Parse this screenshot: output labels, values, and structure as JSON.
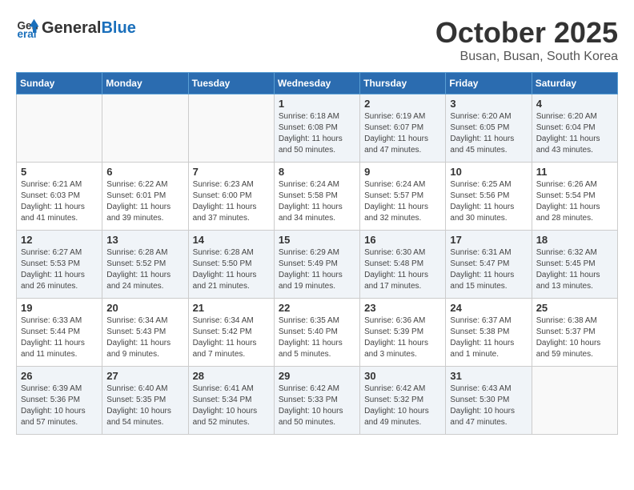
{
  "header": {
    "logo_general": "General",
    "logo_blue": "Blue",
    "month": "October 2025",
    "location": "Busan, Busan, South Korea"
  },
  "weekdays": [
    "Sunday",
    "Monday",
    "Tuesday",
    "Wednesday",
    "Thursday",
    "Friday",
    "Saturday"
  ],
  "weeks": [
    [
      {
        "day": "",
        "info": ""
      },
      {
        "day": "",
        "info": ""
      },
      {
        "day": "",
        "info": ""
      },
      {
        "day": "1",
        "info": "Sunrise: 6:18 AM\nSunset: 6:08 PM\nDaylight: 11 hours\nand 50 minutes."
      },
      {
        "day": "2",
        "info": "Sunrise: 6:19 AM\nSunset: 6:07 PM\nDaylight: 11 hours\nand 47 minutes."
      },
      {
        "day": "3",
        "info": "Sunrise: 6:20 AM\nSunset: 6:05 PM\nDaylight: 11 hours\nand 45 minutes."
      },
      {
        "day": "4",
        "info": "Sunrise: 6:20 AM\nSunset: 6:04 PM\nDaylight: 11 hours\nand 43 minutes."
      }
    ],
    [
      {
        "day": "5",
        "info": "Sunrise: 6:21 AM\nSunset: 6:03 PM\nDaylight: 11 hours\nand 41 minutes."
      },
      {
        "day": "6",
        "info": "Sunrise: 6:22 AM\nSunset: 6:01 PM\nDaylight: 11 hours\nand 39 minutes."
      },
      {
        "day": "7",
        "info": "Sunrise: 6:23 AM\nSunset: 6:00 PM\nDaylight: 11 hours\nand 37 minutes."
      },
      {
        "day": "8",
        "info": "Sunrise: 6:24 AM\nSunset: 5:58 PM\nDaylight: 11 hours\nand 34 minutes."
      },
      {
        "day": "9",
        "info": "Sunrise: 6:24 AM\nSunset: 5:57 PM\nDaylight: 11 hours\nand 32 minutes."
      },
      {
        "day": "10",
        "info": "Sunrise: 6:25 AM\nSunset: 5:56 PM\nDaylight: 11 hours\nand 30 minutes."
      },
      {
        "day": "11",
        "info": "Sunrise: 6:26 AM\nSunset: 5:54 PM\nDaylight: 11 hours\nand 28 minutes."
      }
    ],
    [
      {
        "day": "12",
        "info": "Sunrise: 6:27 AM\nSunset: 5:53 PM\nDaylight: 11 hours\nand 26 minutes."
      },
      {
        "day": "13",
        "info": "Sunrise: 6:28 AM\nSunset: 5:52 PM\nDaylight: 11 hours\nand 24 minutes."
      },
      {
        "day": "14",
        "info": "Sunrise: 6:28 AM\nSunset: 5:50 PM\nDaylight: 11 hours\nand 21 minutes."
      },
      {
        "day": "15",
        "info": "Sunrise: 6:29 AM\nSunset: 5:49 PM\nDaylight: 11 hours\nand 19 minutes."
      },
      {
        "day": "16",
        "info": "Sunrise: 6:30 AM\nSunset: 5:48 PM\nDaylight: 11 hours\nand 17 minutes."
      },
      {
        "day": "17",
        "info": "Sunrise: 6:31 AM\nSunset: 5:47 PM\nDaylight: 11 hours\nand 15 minutes."
      },
      {
        "day": "18",
        "info": "Sunrise: 6:32 AM\nSunset: 5:45 PM\nDaylight: 11 hours\nand 13 minutes."
      }
    ],
    [
      {
        "day": "19",
        "info": "Sunrise: 6:33 AM\nSunset: 5:44 PM\nDaylight: 11 hours\nand 11 minutes."
      },
      {
        "day": "20",
        "info": "Sunrise: 6:34 AM\nSunset: 5:43 PM\nDaylight: 11 hours\nand 9 minutes."
      },
      {
        "day": "21",
        "info": "Sunrise: 6:34 AM\nSunset: 5:42 PM\nDaylight: 11 hours\nand 7 minutes."
      },
      {
        "day": "22",
        "info": "Sunrise: 6:35 AM\nSunset: 5:40 PM\nDaylight: 11 hours\nand 5 minutes."
      },
      {
        "day": "23",
        "info": "Sunrise: 6:36 AM\nSunset: 5:39 PM\nDaylight: 11 hours\nand 3 minutes."
      },
      {
        "day": "24",
        "info": "Sunrise: 6:37 AM\nSunset: 5:38 PM\nDaylight: 11 hours\nand 1 minute."
      },
      {
        "day": "25",
        "info": "Sunrise: 6:38 AM\nSunset: 5:37 PM\nDaylight: 10 hours\nand 59 minutes."
      }
    ],
    [
      {
        "day": "26",
        "info": "Sunrise: 6:39 AM\nSunset: 5:36 PM\nDaylight: 10 hours\nand 57 minutes."
      },
      {
        "day": "27",
        "info": "Sunrise: 6:40 AM\nSunset: 5:35 PM\nDaylight: 10 hours\nand 54 minutes."
      },
      {
        "day": "28",
        "info": "Sunrise: 6:41 AM\nSunset: 5:34 PM\nDaylight: 10 hours\nand 52 minutes."
      },
      {
        "day": "29",
        "info": "Sunrise: 6:42 AM\nSunset: 5:33 PM\nDaylight: 10 hours\nand 50 minutes."
      },
      {
        "day": "30",
        "info": "Sunrise: 6:42 AM\nSunset: 5:32 PM\nDaylight: 10 hours\nand 49 minutes."
      },
      {
        "day": "31",
        "info": "Sunrise: 6:43 AM\nSunset: 5:30 PM\nDaylight: 10 hours\nand 47 minutes."
      },
      {
        "day": "",
        "info": ""
      }
    ]
  ]
}
